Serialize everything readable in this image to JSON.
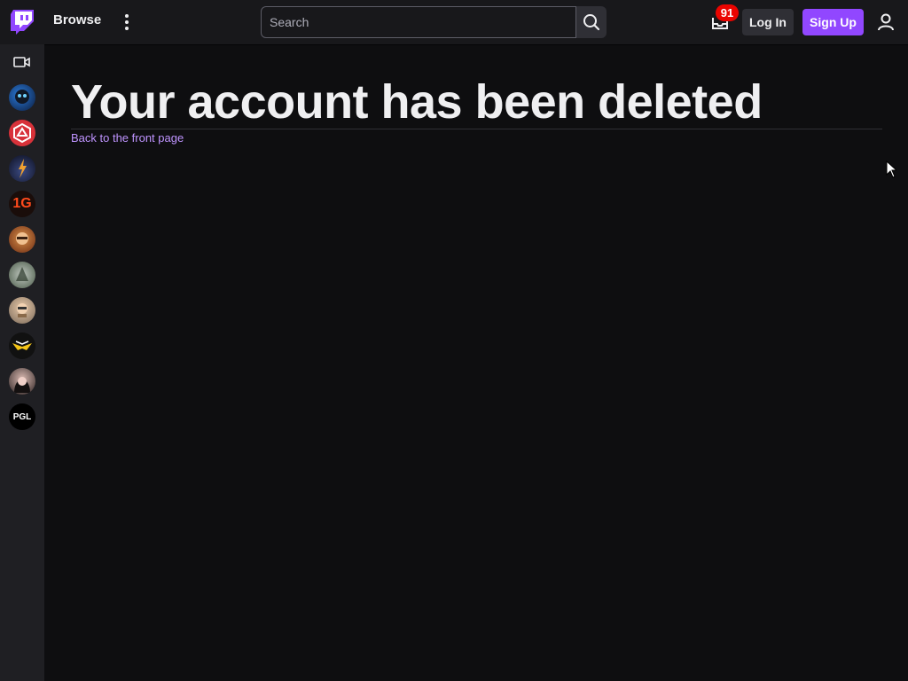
{
  "nav": {
    "browse_label": "Browse",
    "search_placeholder": "Search",
    "notification_count": "91",
    "login_label": "Log In",
    "signup_label": "Sign Up"
  },
  "colors": {
    "brand": "#9147ff",
    "background": "#0e0e10",
    "topbar": "#18181b",
    "sidebar": "#1f1f23",
    "link": "#bf94ff",
    "badge": "#eb0400"
  },
  "sidebar": {
    "channels": [
      {
        "icon": "channel-avatar-1",
        "label": ""
      },
      {
        "icon": "channel-avatar-2",
        "label": ""
      },
      {
        "icon": "channel-avatar-3",
        "label": ""
      },
      {
        "icon": "channel-avatar-4",
        "label": "1G"
      },
      {
        "icon": "channel-avatar-5",
        "label": ""
      },
      {
        "icon": "channel-avatar-6",
        "label": ""
      },
      {
        "icon": "channel-avatar-7",
        "label": ""
      },
      {
        "icon": "channel-avatar-8",
        "label": ""
      },
      {
        "icon": "channel-avatar-9",
        "label": ""
      },
      {
        "icon": "channel-avatar-10",
        "label": "PGL"
      }
    ]
  },
  "main": {
    "title": "Your account has been deleted",
    "back_link": "Back to the front page"
  }
}
